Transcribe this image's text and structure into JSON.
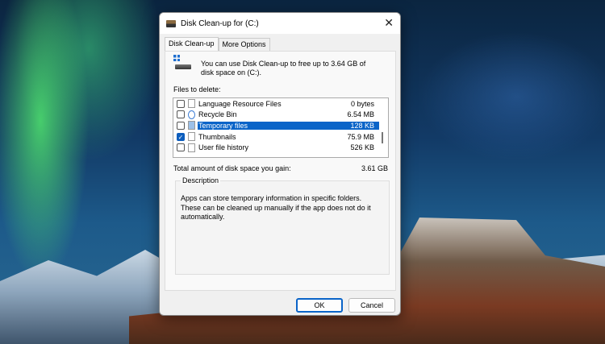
{
  "window": {
    "title": "Disk Clean-up for  (C:)"
  },
  "tabs": [
    "Disk Clean-up",
    "More Options"
  ],
  "info": "You can use Disk Clean-up to free up to 3.64 GB of disk space on  (C:).",
  "files_label": "Files to delete:",
  "files": [
    {
      "name": "Language Resource Files",
      "size": "0 bytes",
      "checked": false
    },
    {
      "name": "Recycle Bin",
      "size": "6.54 MB",
      "checked": false
    },
    {
      "name": "Temporary files",
      "size": "128 KB",
      "checked": false,
      "selected": true
    },
    {
      "name": "Thumbnails",
      "size": "75.9 MB",
      "checked": true
    },
    {
      "name": "User file history",
      "size": "526 KB",
      "checked": false
    }
  ],
  "total_label": "Total amount of disk space you gain:",
  "total_value": "3.61 GB",
  "description": {
    "label": "Description",
    "text": "Apps can store temporary information in specific folders. These can be cleaned up manually if the app does not do it automatically."
  },
  "buttons": {
    "ok": "OK",
    "cancel": "Cancel"
  }
}
